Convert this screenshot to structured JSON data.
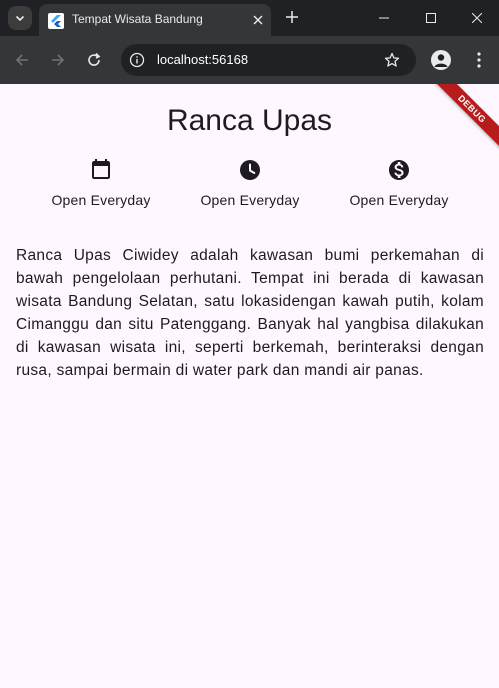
{
  "browser": {
    "tab_title": "Tempat Wisata Bandung",
    "url": "localhost:56168"
  },
  "page": {
    "title": "Ranca Upas",
    "info_items": [
      {
        "icon": "calendar-icon",
        "label": "Open Everyday"
      },
      {
        "icon": "clock-icon",
        "label": "Open Everyday"
      },
      {
        "icon": "money-icon",
        "label": "Open Everyday"
      }
    ],
    "description": "Ranca Upas Ciwidey adalah kawasan bumi perkemahan di bawah pengelolaan perhutani. Tempat ini berada di kawasan wisata Bandung Selatan, satu lokasidengan kawah putih, kolam Cimanggu dan situ Patenggang. Banyak hal yangbisa dilakukan di kawasan wisata ini, seperti berkemah, berinteraksi dengan rusa, sampai bermain di water park dan mandi air panas.",
    "debug_banner": "DEBUG"
  },
  "colors": {
    "page_background": "#fef7ff",
    "text": "#1d1b20",
    "browser_frame": "#202124",
    "browser_toolbar": "#35363a",
    "debug_banner": "#b71c1c"
  }
}
